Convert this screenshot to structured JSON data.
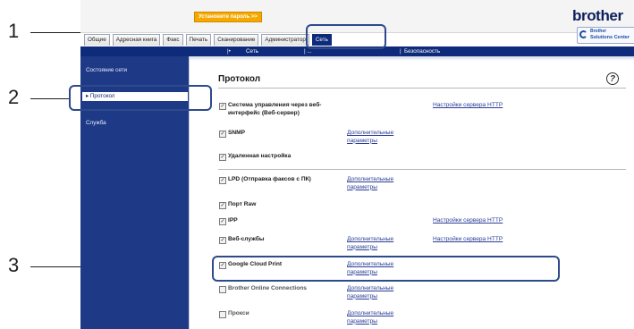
{
  "topbar": {
    "set_password_button": "Установите пароль >>",
    "logo": "brother",
    "solutions_line1": "Brother",
    "solutions_line2": "Solutions Center"
  },
  "tabs": [
    {
      "label": "Общие",
      "active": false
    },
    {
      "label": "Адресная книга",
      "active": false
    },
    {
      "label": "Факс",
      "active": false
    },
    {
      "label": "Печать",
      "active": false
    },
    {
      "label": "Сканирование",
      "active": false
    },
    {
      "label": "Администратор",
      "active": false
    },
    {
      "label": "Сеть",
      "active": true
    }
  ],
  "subnav": {
    "sep": "|•",
    "network": "Сеть",
    "wireless_partial": "| ...",
    "bar": "|",
    "security": "Безопасность"
  },
  "sidebar": {
    "items": [
      {
        "label": "Состояние сети"
      },
      {
        "label": "▸ Протокол"
      },
      {
        "label": "Служба"
      }
    ]
  },
  "page": {
    "title": "Протокол",
    "help_icon": "?"
  },
  "protocols": [
    {
      "label": "Система управления через веб-интерфейс (Веб-сервер)",
      "checked": true,
      "link_advanced": "",
      "link_http": "Настройки сервера HTTP"
    },
    {
      "label": "SNMP",
      "checked": true,
      "link_advanced": "Дополнительные параметры",
      "link_http": ""
    },
    {
      "label": "Удаленная настройка",
      "checked": true,
      "link_advanced": "",
      "link_http": ""
    },
    {
      "label": "LPD (Отправка факсов с ПК)",
      "checked": true,
      "link_advanced": "Дополнительные параметры",
      "link_http": ""
    },
    {
      "label": "Порт Raw",
      "checked": true,
      "link_advanced": "",
      "link_http": ""
    },
    {
      "label": "IPP",
      "checked": true,
      "link_advanced": "",
      "link_http": "Настройки сервера HTTP"
    },
    {
      "label": "Веб-службы",
      "checked": true,
      "link_advanced": "Дополнительные параметры",
      "link_http": "Настройки сервера HTTP"
    },
    {
      "label": "Google Cloud Print",
      "checked": true,
      "link_advanced": "Дополнительные параметры",
      "link_http": ""
    },
    {
      "label": "Brother Online Connections",
      "checked": false,
      "link_advanced": "Дополнительные параметры",
      "link_http": ""
    },
    {
      "label": "Прокси",
      "checked": false,
      "link_advanced": "Дополнительные параметры",
      "link_http": ""
    }
  ],
  "callouts": [
    {
      "number": "1"
    },
    {
      "number": "2"
    },
    {
      "number": "3"
    }
  ],
  "colors": {
    "accent_navy": "#0e2a7a",
    "sidebar_blue": "#1e3a86",
    "password_orange": "#f5a800",
    "callout_outline": "#2c4a8c"
  }
}
